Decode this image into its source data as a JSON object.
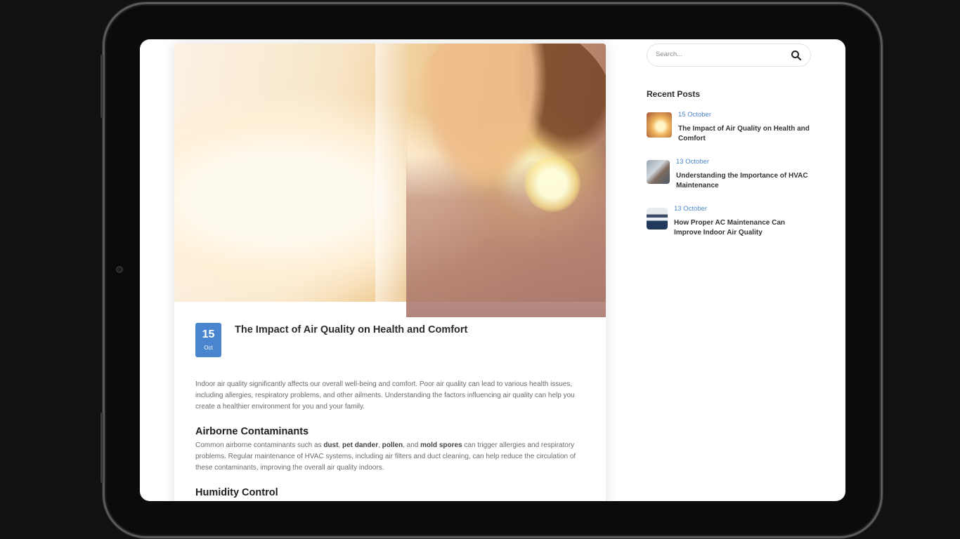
{
  "article": {
    "date_day": "15",
    "date_month": "Oct",
    "title": "The Impact of Air Quality on Health and Comfort",
    "intro": "Indoor air quality significantly affects our overall well-being and comfort. Poor air quality can lead to various health issues, including allergies, respiratory problems, and other ailments. Understanding the factors influencing air quality can help you create a healthier environment for you and your family.",
    "section1_heading": "Airborne Contaminants",
    "section1_text_before": "Common airborne contaminants such as ",
    "section1_bold1": "dust",
    "section1_sep1": ", ",
    "section1_bold2": "pet dander",
    "section1_sep2": ", ",
    "section1_bold3": "pollen",
    "section1_sep3": ", and ",
    "section1_bold4": "mold spores",
    "section1_text_after": " can trigger allergies and respiratory problems. Regular maintenance of HVAC systems, including air filters and duct cleaning, can help reduce the circulation of these contaminants, improving the overall air quality indoors.",
    "section2_heading": "Humidity Control"
  },
  "sidebar": {
    "search_placeholder": "Search...",
    "recent_heading": "Recent Posts",
    "posts": [
      {
        "date": "15 October",
        "title": "The Impact of Air Quality on Health and Comfort"
      },
      {
        "date": "13 October",
        "title": "Understanding the Importance of HVAC Maintenance"
      },
      {
        "date": "13 October",
        "title": "How Proper AC Maintenance Can Improve Indoor Air Quality"
      }
    ]
  },
  "icons": {
    "search": "search-icon",
    "camera": "camera-icon"
  },
  "colors": {
    "accent": "#4a86cf",
    "frame": "#111111"
  }
}
